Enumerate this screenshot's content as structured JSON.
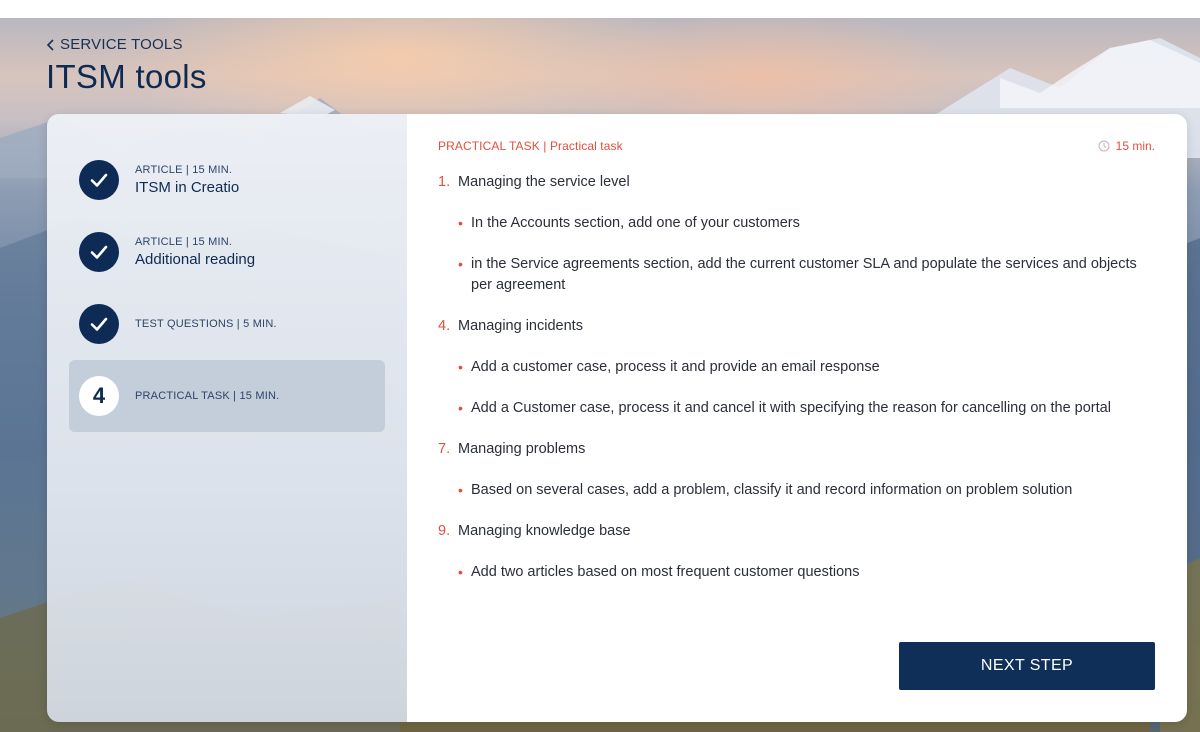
{
  "breadcrumb": {
    "label": "SERVICE TOOLS"
  },
  "page": {
    "title": "ITSM tools"
  },
  "sidebar": {
    "steps": [
      {
        "meta": "ARTICLE | 15 MIN.",
        "title": "ITSM in Creatio",
        "state": "done"
      },
      {
        "meta": "ARTICLE | 15 MIN.",
        "title": "Additional reading",
        "state": "done"
      },
      {
        "meta": "TEST QUESTIONS | 5 MIN.",
        "title": "",
        "state": "done"
      },
      {
        "number": "4",
        "meta": "PRACTICAL TASK | 15 MIN.",
        "title": "",
        "state": "active"
      }
    ]
  },
  "content": {
    "task_label": "PRACTICAL TASK | Practical task",
    "duration": "15 min.",
    "tasks": [
      {
        "number": "1.",
        "title": "Managing the service level",
        "bullets": [
          "In the Accounts section, add one of your customers",
          "in the Service agreements section, add the current customer SLA and populate the services and objects per agreement"
        ]
      },
      {
        "number": "4.",
        "title": "Managing incidents",
        "bullets": [
          "Add a customer case, process it and provide an email response",
          "Add a Customer case, process it and cancel it with specifying the reason for cancelling on the portal"
        ]
      },
      {
        "number": "7.",
        "title": "Managing problems",
        "bullets": [
          "Based on several cases, add a problem, classify it and record information on problem solution"
        ]
      },
      {
        "number": "9.",
        "title": "Managing knowledge base",
        "bullets": [
          "Add two articles based on most frequent customer questions"
        ]
      }
    ],
    "next_label": "NEXT STEP"
  },
  "colors": {
    "accent": "#e0503c",
    "primary": "#0f2e58",
    "active_step_bg": "#c3ceda"
  }
}
